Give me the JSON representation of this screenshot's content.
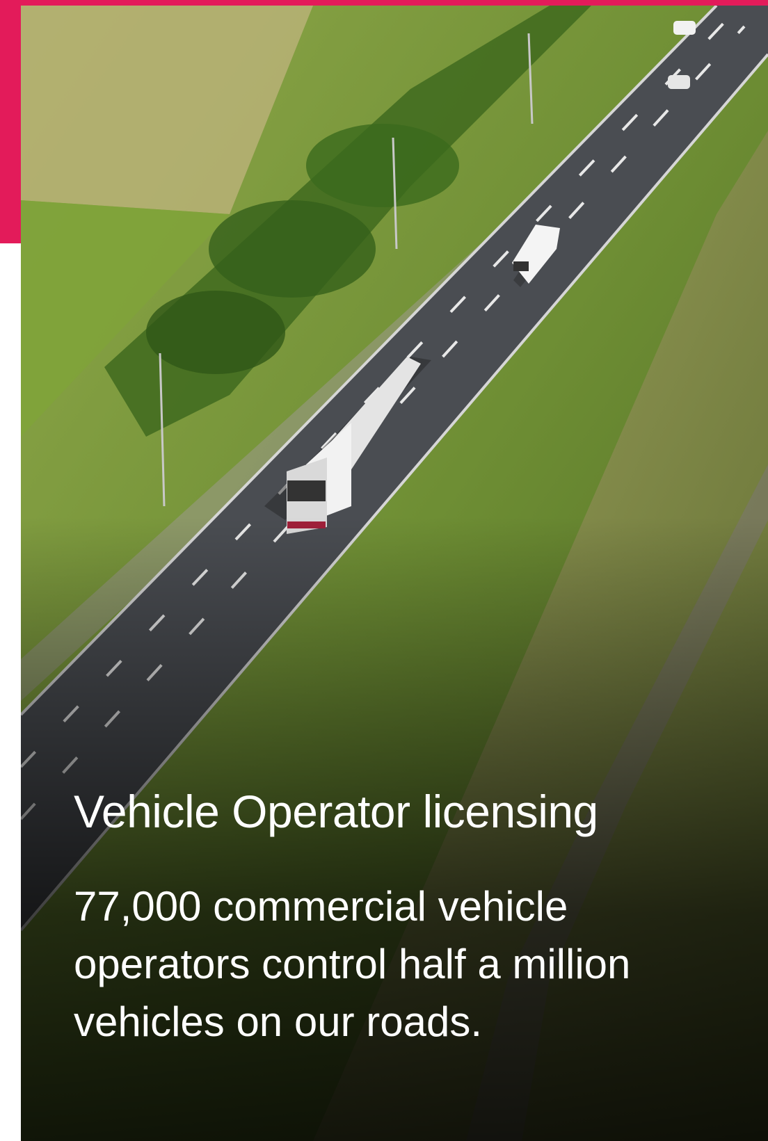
{
  "colors": {
    "accent": "#e31b5a",
    "text": "#ffffff"
  },
  "card": {
    "image_alt_icon": "highway-aerial-photo",
    "title": "Vehicle Operator licensing",
    "description": "77,000 commercial vehicle operators control half a million vehicles on our roads."
  }
}
